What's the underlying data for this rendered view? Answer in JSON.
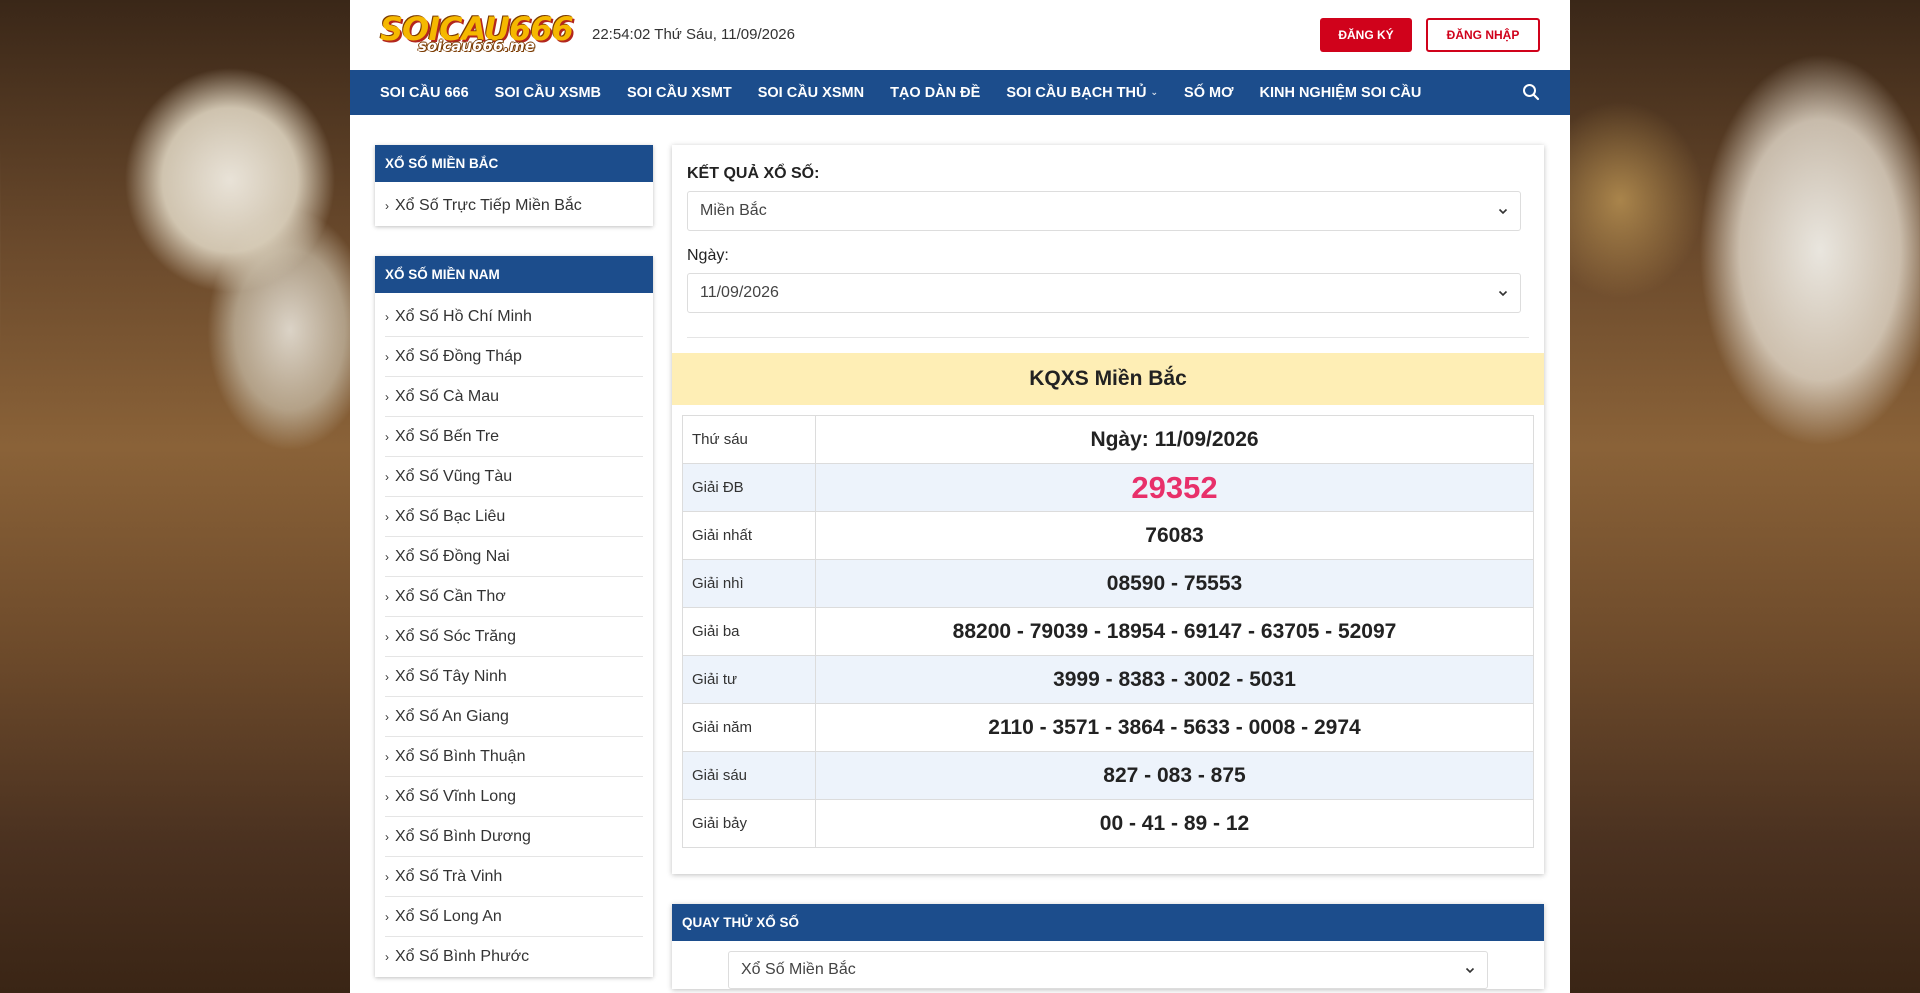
{
  "header": {
    "logo_main": "SOICAU666",
    "logo_sub": "soicau666.me",
    "datetime": "22:54:02 Thứ Sáu, 11/09/2026",
    "register_label": "ĐĂNG KÝ",
    "login_label": "ĐĂNG NHẬP"
  },
  "nav": {
    "items": [
      "SOI CẦU 666",
      "SOI CẦU XSMB",
      "SOI CẦU XSMT",
      "SOI CẦU XSMN",
      "TẠO DÀN ĐỀ",
      "SOI CẦU BẠCH THỦ",
      "SỐ MƠ",
      "KINH NGHIỆM SOI CẦU"
    ],
    "search_icon": "search-icon"
  },
  "sidebar": {
    "north": {
      "title": "XỔ SỐ MIỀN BẮC",
      "items": [
        "Xổ Số Trực Tiếp Miền Bắc"
      ]
    },
    "south": {
      "title": "XỔ SỐ MIỀN NAM",
      "items": [
        "Xổ Số Hồ Chí Minh",
        "Xổ Số Đồng Tháp",
        "Xổ Số Cà Mau",
        "Xổ Số Bến Tre",
        "Xổ Số Vũng Tàu",
        "Xổ Số Bạc Liêu",
        "Xổ Số Đồng Nai",
        "Xổ Số Cần Thơ",
        "Xổ Số Sóc Trăng",
        "Xổ Số Tây Ninh",
        "Xổ Số An Giang",
        "Xổ Số Bình Thuận",
        "Xổ Số Vĩnh Long",
        "Xổ Số Bình Dương",
        "Xổ Số Trà Vinh",
        "Xổ Số Long An",
        "Xổ Số Bình Phước"
      ]
    }
  },
  "main": {
    "result_label": "KẾT QUẢ XỔ SỐ:",
    "region_value": "Miền Bắc",
    "date_label": "Ngày:",
    "date_value": "11/09/2026",
    "kq_title": "KQXS Miền Bắc",
    "table": {
      "day": "Thứ sáu",
      "date_header": "Ngày: 11/09/2026",
      "rows": [
        {
          "label": "Giải ĐB",
          "value": "29352"
        },
        {
          "label": "Giải nhất",
          "value": "76083"
        },
        {
          "label": "Giải nhì",
          "value": "08590 - 75553"
        },
        {
          "label": "Giải ba",
          "value": "88200 - 79039 - 18954 - 69147 - 63705 - 52097"
        },
        {
          "label": "Giải tư",
          "value": "3999 - 8383 - 3002 - 5031"
        },
        {
          "label": "Giải năm",
          "value": "2110 - 3571 - 3864 - 5633 - 0008 - 2974"
        },
        {
          "label": "Giải sáu",
          "value": "827 - 083 - 875"
        },
        {
          "label": "Giải bảy",
          "value": "00 - 41 - 89 - 12"
        }
      ]
    },
    "quay": {
      "title": "QUAY THỬ XỔ SỐ",
      "select_value": "Xổ Số Miền Bắc"
    }
  },
  "colors": {
    "nav_blue": "#1c4d8c",
    "accent_red": "#d0021b",
    "special_prize": "#e8306a",
    "title_band": "#feeeb5"
  }
}
